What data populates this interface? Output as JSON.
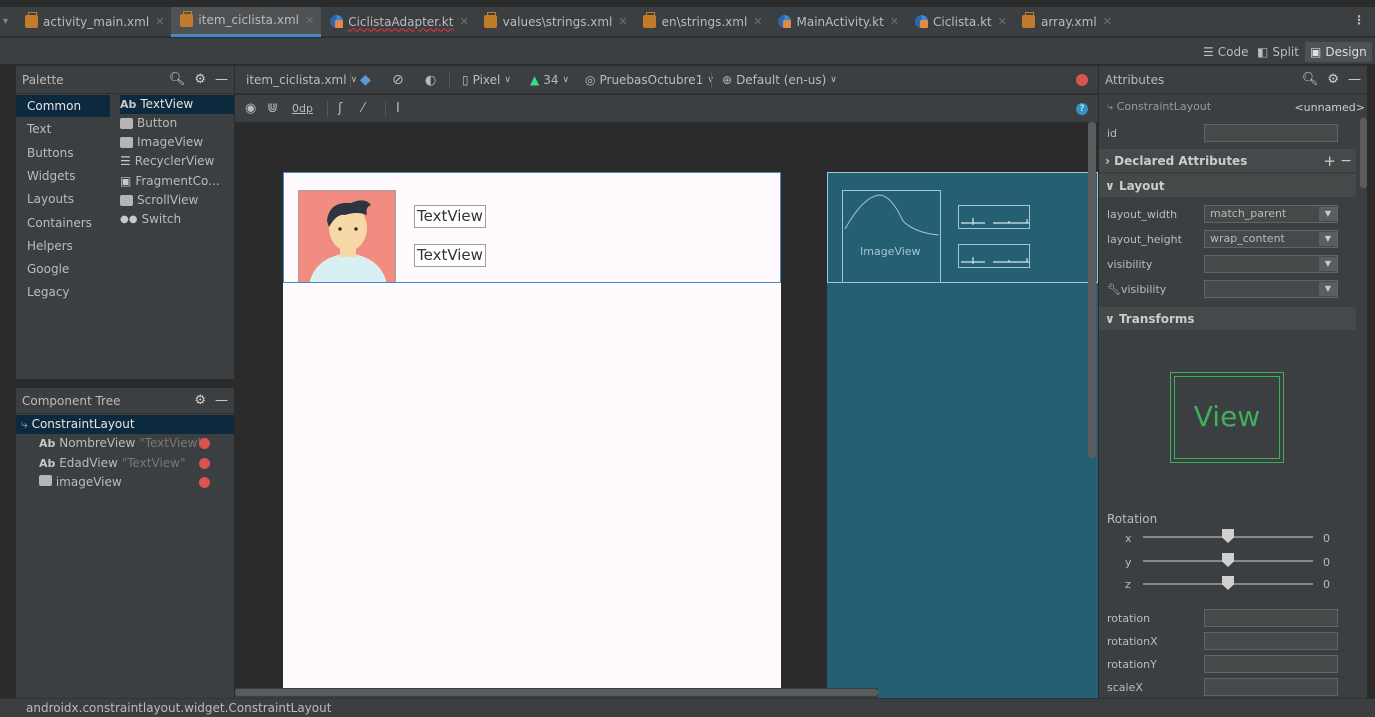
{
  "tabs": [
    {
      "label": "activity_main.xml",
      "icon": "xml-file-icon",
      "active": false,
      "error": false
    },
    {
      "label": "item_ciclista.xml",
      "icon": "xml-file-icon",
      "active": true,
      "error": false
    },
    {
      "label": "CiclistaAdapter.kt",
      "icon": "kotlin-file-icon",
      "active": false,
      "error": true
    },
    {
      "label": "values\\strings.xml",
      "icon": "xml-file-icon",
      "active": false,
      "error": false
    },
    {
      "label": "en\\strings.xml",
      "icon": "xml-file-icon",
      "active": false,
      "error": false
    },
    {
      "label": "MainActivity.kt",
      "icon": "kotlin-file-icon",
      "active": false,
      "error": false
    },
    {
      "label": "Ciclista.kt",
      "icon": "kotlin-file-icon",
      "active": false,
      "error": false
    },
    {
      "label": "array.xml",
      "icon": "xml-file-icon",
      "active": false,
      "error": false
    }
  ],
  "modes": {
    "code": "Code",
    "split": "Split",
    "design": "Design",
    "active": "design"
  },
  "palette": {
    "title": "Palette",
    "categories": [
      "Common",
      "Text",
      "Buttons",
      "Widgets",
      "Layouts",
      "Containers",
      "Helpers",
      "Google",
      "Legacy"
    ],
    "selected_category": "Common",
    "widgets": [
      {
        "label": "TextView",
        "icon": "ab-text-icon"
      },
      {
        "label": "Button",
        "icon": "button-icon"
      },
      {
        "label": "ImageView",
        "icon": "image-icon"
      },
      {
        "label": "RecyclerView",
        "icon": "list-icon"
      },
      {
        "label": "FragmentCo...",
        "icon": "fragment-icon"
      },
      {
        "label": "ScrollView",
        "icon": "scroll-icon"
      },
      {
        "label": "Switch",
        "icon": "toggle-icon"
      }
    ]
  },
  "component_tree": {
    "title": "Component Tree",
    "nodes": [
      {
        "label": "ConstraintLayout",
        "hint": "",
        "indent": 0,
        "error": false
      },
      {
        "label": "NombreView",
        "hint": "\"TextView\"",
        "indent": 1,
        "error": true
      },
      {
        "label": "EdadView",
        "hint": "\"TextView\"",
        "indent": 1,
        "error": true
      },
      {
        "label": "imageView",
        "hint": "",
        "indent": 1,
        "error": true
      }
    ]
  },
  "design_toolbar": {
    "file": "item_ciclista.xml",
    "device": "Pixel",
    "api": "34",
    "theme": "PruebasOctubre1",
    "locale": "Default (en-us)",
    "margin": "0dp"
  },
  "preview": {
    "text1": "TextView",
    "text2": "TextView",
    "blueprint_image_label": "ImageView"
  },
  "attributes": {
    "title": "Attributes",
    "component": "ConstraintLayout",
    "component_name": "<unnamed>",
    "id_label": "id",
    "id_value": "",
    "declared_label": "Declared Attributes",
    "layout_label": "Layout",
    "layout_rows": [
      {
        "label": "layout_width",
        "value": "match_parent"
      },
      {
        "label": "layout_height",
        "value": "wrap_content"
      },
      {
        "label": "visibility",
        "value": ""
      },
      {
        "label": "visibility",
        "value": ""
      }
    ],
    "transforms_label": "Transforms",
    "view_preview": "View",
    "rotation_label": "Rotation",
    "rotation_axes": [
      {
        "axis": "x",
        "value": "0"
      },
      {
        "axis": "y",
        "value": "0"
      },
      {
        "axis": "z",
        "value": "0"
      }
    ],
    "transform_rows": [
      {
        "label": "rotation",
        "value": ""
      },
      {
        "label": "rotationX",
        "value": ""
      },
      {
        "label": "rotationY",
        "value": ""
      },
      {
        "label": "scaleX",
        "value": ""
      }
    ]
  },
  "status_bar": "androidx.constraintlayout.widget.ConstraintLayout",
  "colors": {
    "accent": "#4a88c7",
    "selection": "#0d293e",
    "blueprint": "#245f73",
    "error": "#d9534f",
    "view_green": "#3fb05a"
  }
}
